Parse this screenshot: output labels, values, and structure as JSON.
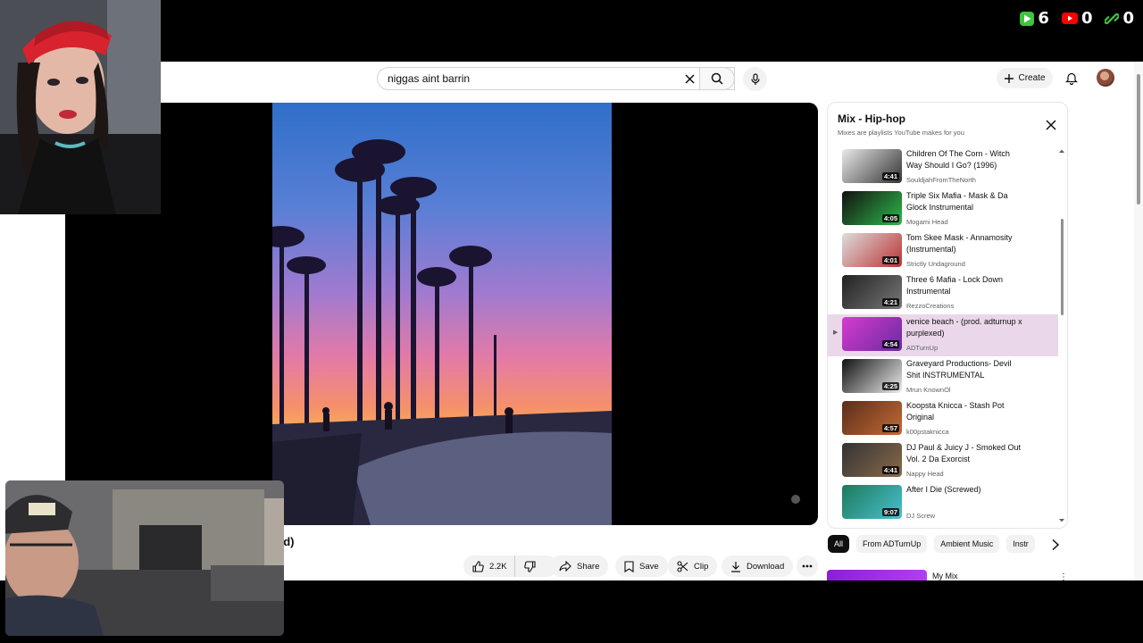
{
  "overlay_stats": [
    {
      "icon": "play-icon",
      "value": "6",
      "color": "#3ec43e"
    },
    {
      "icon": "youtube-icon",
      "value": "0",
      "color": "#ff0000"
    },
    {
      "icon": "link-icon",
      "value": "0",
      "color": "#3ec43e"
    }
  ],
  "search": {
    "query": "niggas aint barrin"
  },
  "header": {
    "create_label": "Create"
  },
  "video": {
    "title_fragment": "ed)"
  },
  "actions": {
    "like_count": "2.2K",
    "share_label": "Share",
    "save_label": "Save",
    "clip_label": "Clip",
    "download_label": "Download"
  },
  "playlist": {
    "title": "Mix - Hip-hop",
    "subtitle": "Mixes are playlists YouTube makes for you",
    "items": [
      {
        "title": "Children Of The Corn - Witch Way Should I Go? (1996)",
        "channel": "SouldjahFromTheNorth",
        "duration": "4:41",
        "active": false
      },
      {
        "title": "Triple Six Mafia - Mask & Da Glock Instrumental",
        "channel": "Mogami Head",
        "duration": "4:05",
        "active": false
      },
      {
        "title": "Tom Skee Mask - Annamosity (Instrumental)",
        "channel": "Strictly Undaground",
        "duration": "4:01",
        "active": false
      },
      {
        "title": "Three 6 Mafia - Lock Down Instrumental",
        "channel": "RezzoCreations",
        "duration": "4:21",
        "active": false
      },
      {
        "title": "venice beach - (prod. adturnup x purplexed)",
        "channel": "ADTurnUp",
        "duration": "4:54",
        "active": true
      },
      {
        "title": "Graveyard Productions- Devil Shit INSTRUMENTAL",
        "channel": "Mrun KnownOl",
        "duration": "4:25",
        "active": false
      },
      {
        "title": "Koopsta Knicca - Stash Pot Original",
        "channel": "k00pstaknicca",
        "duration": "4:57",
        "active": false
      },
      {
        "title": "DJ Paul & Juicy J - Smoked Out Vol. 2 Da Exorcist",
        "channel": "Nappy Head",
        "duration": "4:41",
        "active": false
      },
      {
        "title": "After I Die (Screwed)",
        "channel": "DJ Screw",
        "duration": "9:07",
        "active": false
      }
    ]
  },
  "chips": [
    "All",
    "From ADTurnUp",
    "Ambient Music",
    "Instr"
  ],
  "mix_card": {
    "label": "My Mix"
  }
}
